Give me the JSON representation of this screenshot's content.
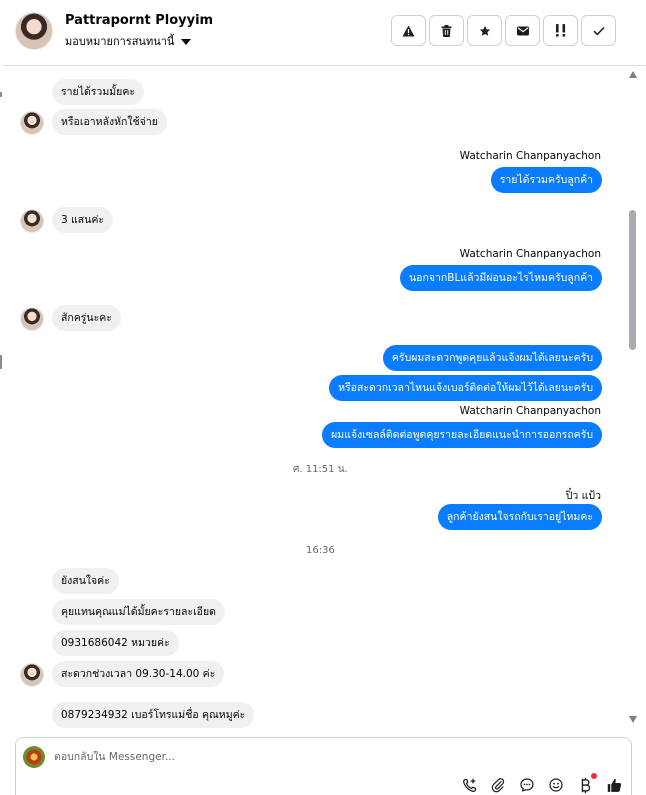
{
  "header": {
    "contact_name": "Pattrapornt Ployyim",
    "assign_label": "มอบหมายการสนทนานี้",
    "actions": [
      "spam-warning-icon",
      "trash-icon",
      "star-icon",
      "envelope-icon",
      "urgent-icon",
      "check-icon"
    ]
  },
  "messages": {
    "m1": "รายได้รวมมั้ยคะ",
    "m2": "หรือเอาหลังหักใช้จ่าย",
    "sender1": "Watcharin Chanpanyachon",
    "m3": "รายได้รวมครับลูกค้า",
    "m4": "3 แสนค่ะ",
    "sender2": "Watcharin Chanpanyachon",
    "m5": "นอกจากBLแล้วมีผ่อนอะไรไหมครับลูกค้า",
    "m6": "สักครู่นะคะ",
    "m7": "ครับผมสะดวกพูดคุยแล้วแจ้งผมได้เลยนะครับ",
    "m8": "หรือสะดวกเวลาไหนแจ้งเบอร์ติดต่อให้ผมไว้ได้เลยนะครับ",
    "sender3": "Watcharin Chanpanyachon",
    "m9": "ผมแจ้งเซลล์ติดต่อพูดคุยรายละเอียดแนะนำการออกรถครับ",
    "time1": "ศ. 11:51 น.",
    "sender4": "ปิ๋ว แป้ว",
    "m10": "ลูกค้ายังสนใจรถกับเราอยู่ไหมคะ",
    "time2": "16:36",
    "m11": "ยังสนใจค่ะ",
    "m12": "คุยแทนคุณแม่ได้มั้ยคะรายละเอียด",
    "m13": "0931686042 หมวยค่ะ",
    "m14": "สะดวกช่วงเวลา 09.30-14.00 ค่ะ",
    "m15": "0879234932 เบอร์โทรแม่ชื่อ คุณหมูค่ะ"
  },
  "composer": {
    "placeholder": "ตอบกลับใน Messenger...",
    "tools": [
      "add-call-icon",
      "attachment-icon",
      "saved-replies-icon",
      "emoji-icon",
      "baht-payment-icon",
      "thumbs-up-icon"
    ]
  },
  "colors": {
    "outgoing": "#0a7cff",
    "incoming": "#f0f0f0",
    "badge": "#f02849"
  }
}
